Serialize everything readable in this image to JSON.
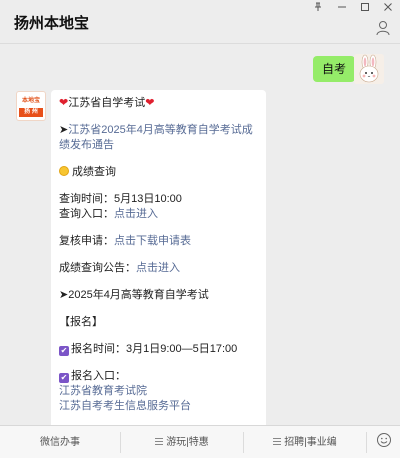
{
  "window": {
    "title": "扬州本地宝",
    "pin_icon": "pin-icon",
    "minimize_icon": "minimize-icon",
    "maximize_icon": "maximize-icon",
    "close_icon": "close-icon",
    "profile_icon": "person-icon"
  },
  "chat": {
    "user_message": "自考",
    "bot_avatar": {
      "top_text": "本地宝",
      "bottom_text": "扬 州",
      "brand_color": "#e8501a"
    },
    "reply": {
      "heading": "江苏省自学考试",
      "notice_link": "江苏省2025年4月高等教育自学考试成绩发布通告",
      "score_query_title": "成绩查询",
      "query_time_label": "查询时间：",
      "query_time_value": "5月13日10:00",
      "query_entry_label": "查询入口：",
      "query_entry_link": "点击进入",
      "review_label": "复核申请：",
      "review_link": "点击下载申请表",
      "announcement_label": "成绩查询公告：",
      "announcement_link": "点击进入",
      "exam_title": "2025年4月高等教育自学考试",
      "registration_header": "【报名】",
      "registration_time_label": "报名时间：",
      "registration_time_value": "3月1日9:00—5日17:00",
      "registration_entry_label": "报名入口：",
      "registration_link_1": "江苏省教育考试院",
      "registration_link_2": "江苏自考考生信息服务平台"
    }
  },
  "bottom_menu": {
    "items": [
      "微信办事",
      "游玩|特惠",
      "招聘|事业编"
    ],
    "emoji_icon": "smile-icon"
  },
  "colors": {
    "my_bubble": "#95ec69",
    "link": "#576b95",
    "background": "#ededed"
  }
}
